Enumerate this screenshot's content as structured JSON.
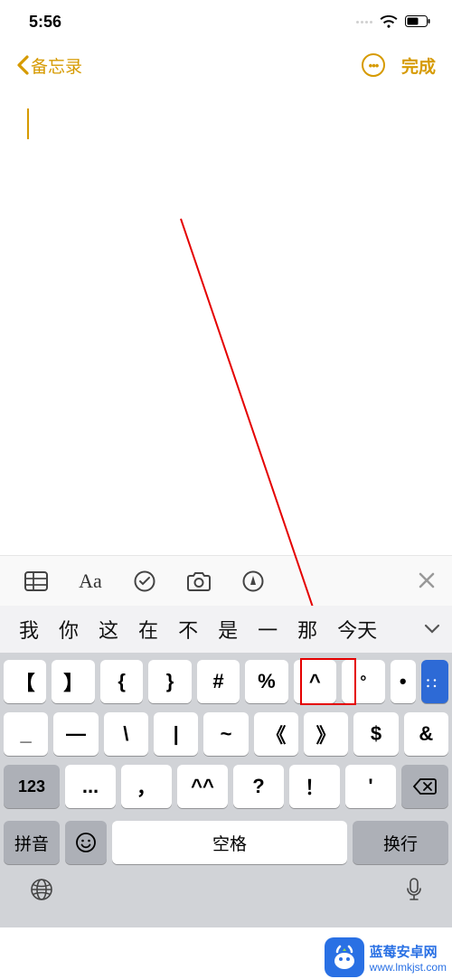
{
  "status": {
    "time": "5:56"
  },
  "nav": {
    "back_label": "备忘录",
    "done_label": "完成"
  },
  "toolbar": {},
  "suggestions": [
    "我",
    "你",
    "这",
    "在",
    "不",
    "是",
    "一",
    "那",
    "今天"
  ],
  "keyboard": {
    "row1": [
      "【",
      "】",
      "{",
      "}",
      "#",
      "%",
      "^"
    ],
    "row1_hl": "°",
    "row1_dot": "•",
    "row1_blue": "：：",
    "row2": [
      "_",
      "—",
      "\\",
      "|",
      "~",
      "《",
      "》",
      "$",
      "&"
    ],
    "row3_num": "123",
    "row3": [
      "...",
      "，",
      "^^",
      "?",
      "！",
      "'"
    ],
    "pinyin_label": "拼音",
    "space_label": "空格",
    "enter_label": "换行"
  },
  "colors": {
    "accent": "#d69a00",
    "arrow": "#e40000",
    "watermark": "#2970e4"
  },
  "watermark": {
    "title": "蓝莓安卓网",
    "url": "www.lmkjst.com"
  }
}
